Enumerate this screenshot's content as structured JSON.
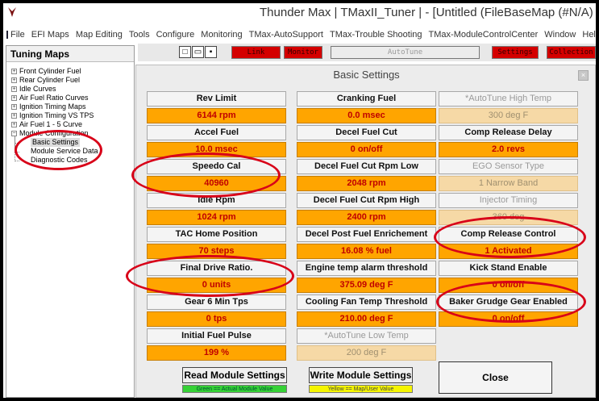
{
  "window": {
    "title": "Thunder Max  |  TMaxII_Tuner  |   - [Untitled     (FileBaseMap (#N/A)"
  },
  "menu": [
    "File",
    "EFI Maps",
    "Map Editing",
    "Tools",
    "Configure",
    "Monitoring",
    "TMax-AutoSupport",
    "TMax-Trouble Shooting",
    "TMax-ModuleControlCenter",
    "Window",
    "Help"
  ],
  "tree": {
    "header": "Tuning Maps",
    "items": [
      "Front Cylinder Fuel",
      "Rear Cylinder Fuel",
      "Idle Curves",
      "Air Fuel Ratio Curves",
      "Ignition Timing Maps",
      "Ignition Timing VS TPS",
      "Air Fuel 1 - 5 Curve",
      "Module Configuration"
    ],
    "children": [
      "Basic Settings",
      "Module Service Data",
      "Diagnostic Codes"
    ]
  },
  "toolbar": {
    "link": "Link",
    "monitor": "Monitor",
    "autotune": "AutoTune",
    "settings": "Settings",
    "collection": "Collection"
  },
  "dialog": {
    "title": "Basic Settings",
    "close_x": "×",
    "fields": [
      {
        "label": "Rev Limit",
        "value": "6144 rpm"
      },
      {
        "label": "Cranking Fuel",
        "value": "0.0 msec"
      },
      {
        "label": "*AutoTune High Temp",
        "value": "300 deg F"
      },
      {
        "label": "Accel Fuel",
        "value": "10.0 msec"
      },
      {
        "label": "Decel Fuel Cut",
        "value": "0 on/off"
      },
      {
        "label": "Comp Release Delay",
        "value": "2.0 revs"
      },
      {
        "label": "Speedo Cal",
        "value": "40960"
      },
      {
        "label": "Decel Fuel Cut Rpm Low",
        "value": "2048 rpm"
      },
      {
        "label": "EGO Sensor Type",
        "value": "1 Narrow Band"
      },
      {
        "label": "Idle Rpm",
        "value": "1024 rpm"
      },
      {
        "label": "Decel Fuel Cut Rpm High",
        "value": "2400 rpm"
      },
      {
        "label": "Injector Timing",
        "value": "360 deg"
      },
      {
        "label": "TAC Home Position",
        "value": "70 steps"
      },
      {
        "label": "Decel Post Fuel Enrichement",
        "value": "16.08 % fuel"
      },
      {
        "label": "Comp Release Control",
        "value": "1 Activated"
      },
      {
        "label": "Final Drive Ratio.",
        "value": "0 units"
      },
      {
        "label": "Engine temp alarm threshold",
        "value": "375.09 deg F"
      },
      {
        "label": "Kick Stand Enable",
        "value": "0 on/off"
      },
      {
        "label": "Gear 6 Min Tps",
        "value": "0 tps"
      },
      {
        "label": "Cooling Fan Temp Threshold",
        "value": "210.00 deg F"
      },
      {
        "label": "Baker Grudge Gear Enabled",
        "value": "0 on/off"
      },
      {
        "label": "Initial Fuel Pulse",
        "value": "199 %"
      },
      {
        "label": "*AutoTune Low Temp",
        "value": "200 deg F"
      }
    ],
    "read_button": "Read Module Settings",
    "write_button": "Write Module Settings",
    "close_button": "Close",
    "legend_green": "Green == Actual Module Value",
    "legend_yellow": "Yellow == Map/User Value"
  },
  "colors": {
    "value_bg": "#ffa500",
    "value_text": "#c00000",
    "annotation": "#d80018"
  }
}
